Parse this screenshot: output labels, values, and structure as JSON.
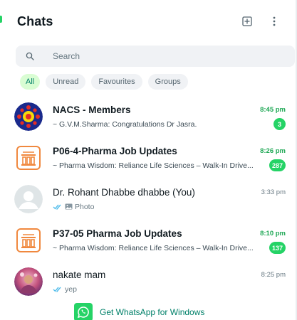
{
  "header": {
    "title": "Chats",
    "new_chat_icon": "new-chat-icon",
    "menu_icon": "kebab-menu-icon"
  },
  "search": {
    "placeholder": "Search",
    "value": ""
  },
  "filters": [
    {
      "label": "All",
      "active": true
    },
    {
      "label": "Unread",
      "active": false
    },
    {
      "label": "Favourites",
      "active": false
    },
    {
      "label": "Groups",
      "active": false
    }
  ],
  "chats": [
    {
      "name": "NACS - Members",
      "time": "8:45 pm",
      "preview": "~ G.V.M.Sharma: Congratulations Dr Jasra.",
      "unread": "3"
    },
    {
      "name": "P06-4-Pharma Job Updates",
      "time": "8:26 pm",
      "preview": "~ Pharma Wisdom: Reliance Life Sciences – Walk-In Drive...",
      "unread": "287"
    },
    {
      "name": "Dr. Rohant Dhabbe dhabbe (You)",
      "time": "3:33 pm",
      "preview": "Photo"
    },
    {
      "name": "P37-05 Pharma Job Updates",
      "time": "8:10 pm",
      "preview": "~ Pharma Wisdom: Reliance Life Sciences – Walk-In Drive...",
      "unread": "137"
    },
    {
      "name": "nakate mam",
      "time": "8:25 pm",
      "preview": "yep"
    }
  ],
  "promo": {
    "label": "Get WhatsApp for Windows"
  },
  "colors": {
    "accent": "#25d366",
    "unread_time": "#1fa855",
    "active_chip_bg": "#d9fdd3",
    "active_chip_text": "#008069",
    "tick": "#53bdeb"
  }
}
